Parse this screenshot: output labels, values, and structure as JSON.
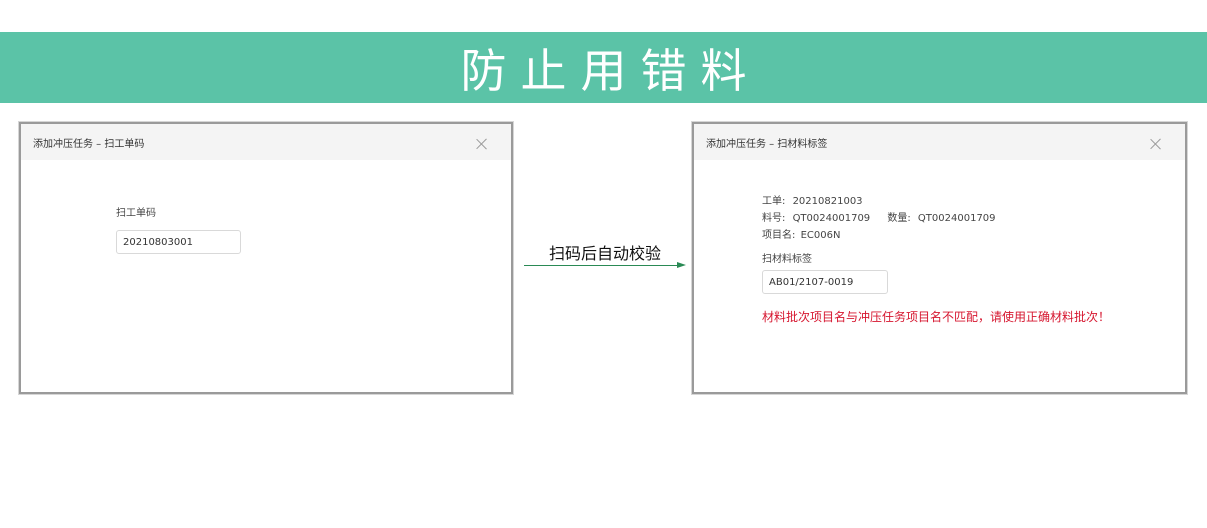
{
  "banner": {
    "title": "防止用错料"
  },
  "left_dialog": {
    "title": "添加冲压任务 – 扫工单码",
    "field_label": "扫工单码",
    "input_value": "20210803001"
  },
  "flow": {
    "label": "扫码后自动校验"
  },
  "right_dialog": {
    "title": "添加冲压任务 – 扫材料标签",
    "work_order_label": "工单:",
    "work_order_value": "20210821003",
    "part_no_label": "料号:",
    "part_no_value": "QT0024001709",
    "quantity_label": "数量:",
    "quantity_value": "QT0024001709",
    "project_label": "项目名:",
    "project_value": "EC006N",
    "field_label": "扫材料标签",
    "input_value": "AB01/2107-0019",
    "error_message": "材料批次项目名与冲压任务项目名不匹配，请使用正确材料批次！"
  },
  "colors": {
    "banner_bg": "#5bc3a7",
    "error_text": "#d6162f",
    "arrow": "#2a8a55"
  }
}
